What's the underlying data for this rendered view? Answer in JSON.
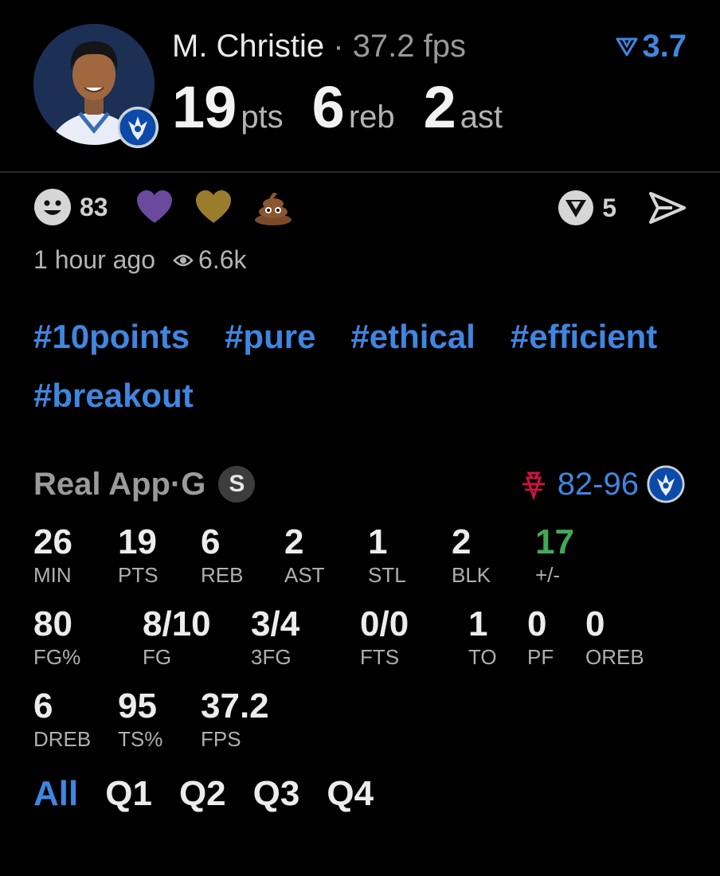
{
  "player": {
    "name": "M. Christie",
    "separator": " · ",
    "fps": "37.2 fps",
    "vote": "3.7",
    "pts": "19",
    "pts_label": "pts",
    "reb": "6",
    "reb_label": "reb",
    "ast": "2",
    "ast_label": "ast"
  },
  "reactions": {
    "smile_count": "83",
    "items": [
      "smile-icon",
      "purple-heart-icon",
      "gold-heart-icon",
      "poop-icon"
    ],
    "vote_count": "5"
  },
  "meta": {
    "time": "1 hour ago",
    "views": "6.6k"
  },
  "tags": [
    "#10points",
    "#pure",
    "#ethical",
    "#efficient",
    "#breakout"
  ],
  "game": {
    "source": "Real App",
    "separator": " · ",
    "position": "G",
    "badge": "S",
    "score": "82-96"
  },
  "stats": [
    {
      "value": "26",
      "label": "MIN"
    },
    {
      "value": "19",
      "label": "PTS"
    },
    {
      "value": "6",
      "label": "REB"
    },
    {
      "value": "2",
      "label": "AST"
    },
    {
      "value": "1",
      "label": "STL"
    },
    {
      "value": "2",
      "label": "BLK"
    },
    {
      "value": "17",
      "label": "+/-"
    },
    {
      "value": "80",
      "label": "FG%"
    },
    {
      "value": "8/10",
      "label": "FG"
    },
    {
      "value": "3/4",
      "label": "3FG"
    },
    {
      "value": "0/0",
      "label": "FTS"
    },
    {
      "value": "1",
      "label": "TO"
    },
    {
      "value": "0",
      "label": "PF"
    },
    {
      "value": "0",
      "label": "OREB"
    },
    {
      "value": "6",
      "label": "DREB"
    },
    {
      "value": "95",
      "label": "TS%"
    },
    {
      "value": "37.2",
      "label": "FPS"
    }
  ],
  "quarters": [
    "All",
    "Q1",
    "Q2",
    "Q3",
    "Q4"
  ],
  "active_quarter": "All",
  "colors": {
    "accent": "#3f86e0",
    "positive": "#41a85a",
    "rockets_red": "#ce1141",
    "purple_heart": "#6a4a9c",
    "gold_heart": "#9a7d2c"
  }
}
